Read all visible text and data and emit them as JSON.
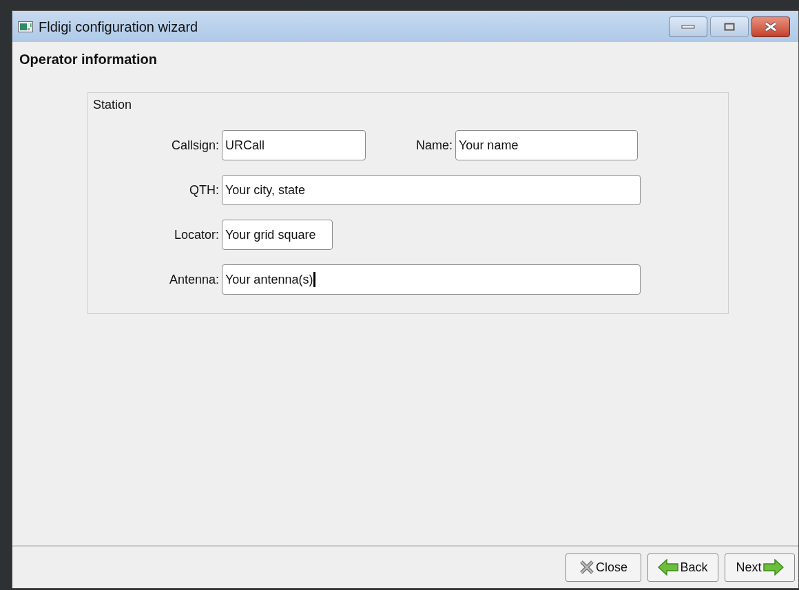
{
  "window": {
    "title": "Fldigi configuration wizard"
  },
  "page_title": "Operator information",
  "group": {
    "title": "Station",
    "rows": [
      {
        "fields": [
          {
            "label": "Callsign:",
            "value": "URCall",
            "focused": false
          },
          {
            "label": "Name:",
            "value": "Your name",
            "focused": false
          }
        ]
      },
      {
        "fields": [
          {
            "label": "QTH:",
            "value": "Your city, state",
            "focused": false
          }
        ]
      },
      {
        "fields": [
          {
            "label": "Locator:",
            "value": "Your grid square",
            "focused": false
          }
        ]
      },
      {
        "fields": [
          {
            "label": "Antenna:",
            "value": "Your antenna(s)",
            "focused": true
          }
        ]
      }
    ]
  },
  "buttons": [
    {
      "label": "Close",
      "kind": "close"
    },
    {
      "label": "Back",
      "kind": "back"
    },
    {
      "label": "Next",
      "kind": "next"
    }
  ]
}
